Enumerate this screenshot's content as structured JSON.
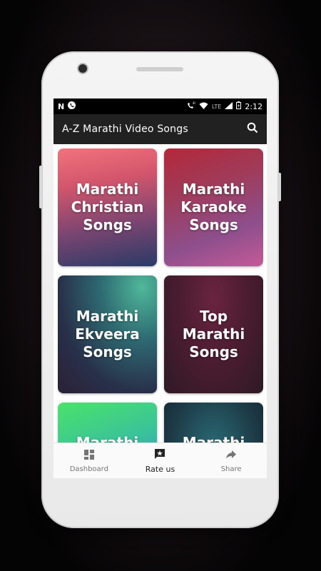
{
  "statusbar": {
    "left_icons": [
      "nfc-icon",
      "phone-call-icon"
    ],
    "network": "LTE",
    "time": "2:12"
  },
  "toolbar": {
    "title": "A-Z Marathi Video Songs",
    "search_icon": "search-icon"
  },
  "cards": [
    {
      "label": "Marathi Christian Songs"
    },
    {
      "label": "Marathi Karaoke Songs"
    },
    {
      "label": "Marathi Ekveera Songs"
    },
    {
      "label": "Top Marathi Songs"
    },
    {
      "label": "Marathi"
    },
    {
      "label": "Marathi"
    }
  ],
  "bottom_nav": {
    "items": [
      {
        "label": "Dashboard",
        "icon": "dashboard-icon"
      },
      {
        "label": "Rate us",
        "icon": "rate-icon"
      },
      {
        "label": "Share",
        "icon": "share-icon"
      }
    ],
    "active": "Rate us"
  },
  "colors": {
    "toolbar_bg": "#212121",
    "statusbar_bg": "#000000",
    "nav_bg": "#fafafa"
  }
}
